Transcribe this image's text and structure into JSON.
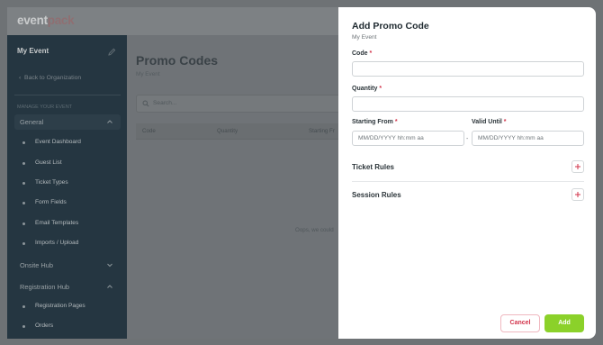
{
  "app": {
    "logo_part1": "event",
    "logo_part2": "pack"
  },
  "sidebar": {
    "event_name": "My Event",
    "back_link": "Back to Organization",
    "section_label": "MANAGE YOUR EVENT",
    "groups": [
      {
        "label": "General",
        "expanded": true,
        "items": [
          "Event Dashboard",
          "Guest List",
          "Ticket Types",
          "Form Fields",
          "Email Templates",
          "Imports / Upload"
        ]
      },
      {
        "label": "Onsite Hub",
        "expanded": false,
        "items": []
      },
      {
        "label": "Registration Hub",
        "expanded": true,
        "items": [
          "Registration Pages",
          "Orders"
        ]
      }
    ]
  },
  "main": {
    "title": "Promo Codes",
    "subtitle": "My Event",
    "search_placeholder": "Search...",
    "columns": [
      "Code",
      "Quantity",
      "Starting Fr"
    ],
    "empty_text": "Oops, we could"
  },
  "modal": {
    "title": "Add Promo Code",
    "subtitle": "My Event",
    "code_label": "Code",
    "quantity_label": "Quantity",
    "starting_label": "Starting From",
    "valid_label": "Valid Until",
    "required_mark": "*",
    "date_placeholder": "MM/DD/YYYY hh:mm aa",
    "date_separator": "-",
    "ticket_rules_label": "Ticket Rules",
    "session_rules_label": "Session Rules",
    "cancel_label": "Cancel",
    "add_label": "Add"
  },
  "colors": {
    "accent_green": "#8bd12a",
    "danger_red": "#d2334a",
    "sidebar_bg": "#253641"
  }
}
